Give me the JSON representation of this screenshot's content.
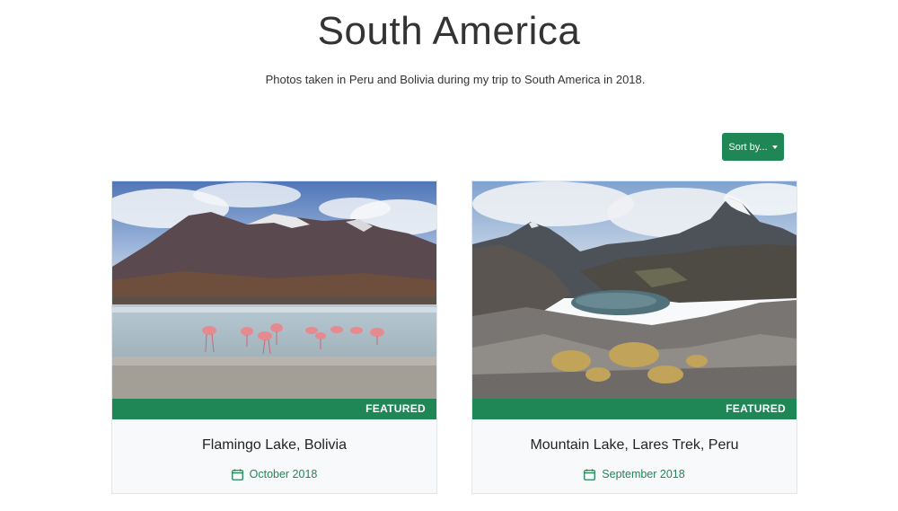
{
  "header": {
    "title": "South America",
    "subtitle": "Photos taken in Peru and Bolivia during my trip to South America in 2018."
  },
  "toolbar": {
    "sort_label": "Sort by..."
  },
  "cards": [
    {
      "badge": "FEATURED",
      "title": "Flamingo Lake, Bolivia",
      "date": "October 2018",
      "icon": "calendar-icon"
    },
    {
      "badge": "FEATURED",
      "title": "Mountain Lake, Lares Trek, Peru",
      "date": "September 2018",
      "icon": "calendar-icon"
    }
  ],
  "colors": {
    "accent": "#1e8755",
    "card_bg": "#f8f9fa",
    "text": "#212529"
  }
}
